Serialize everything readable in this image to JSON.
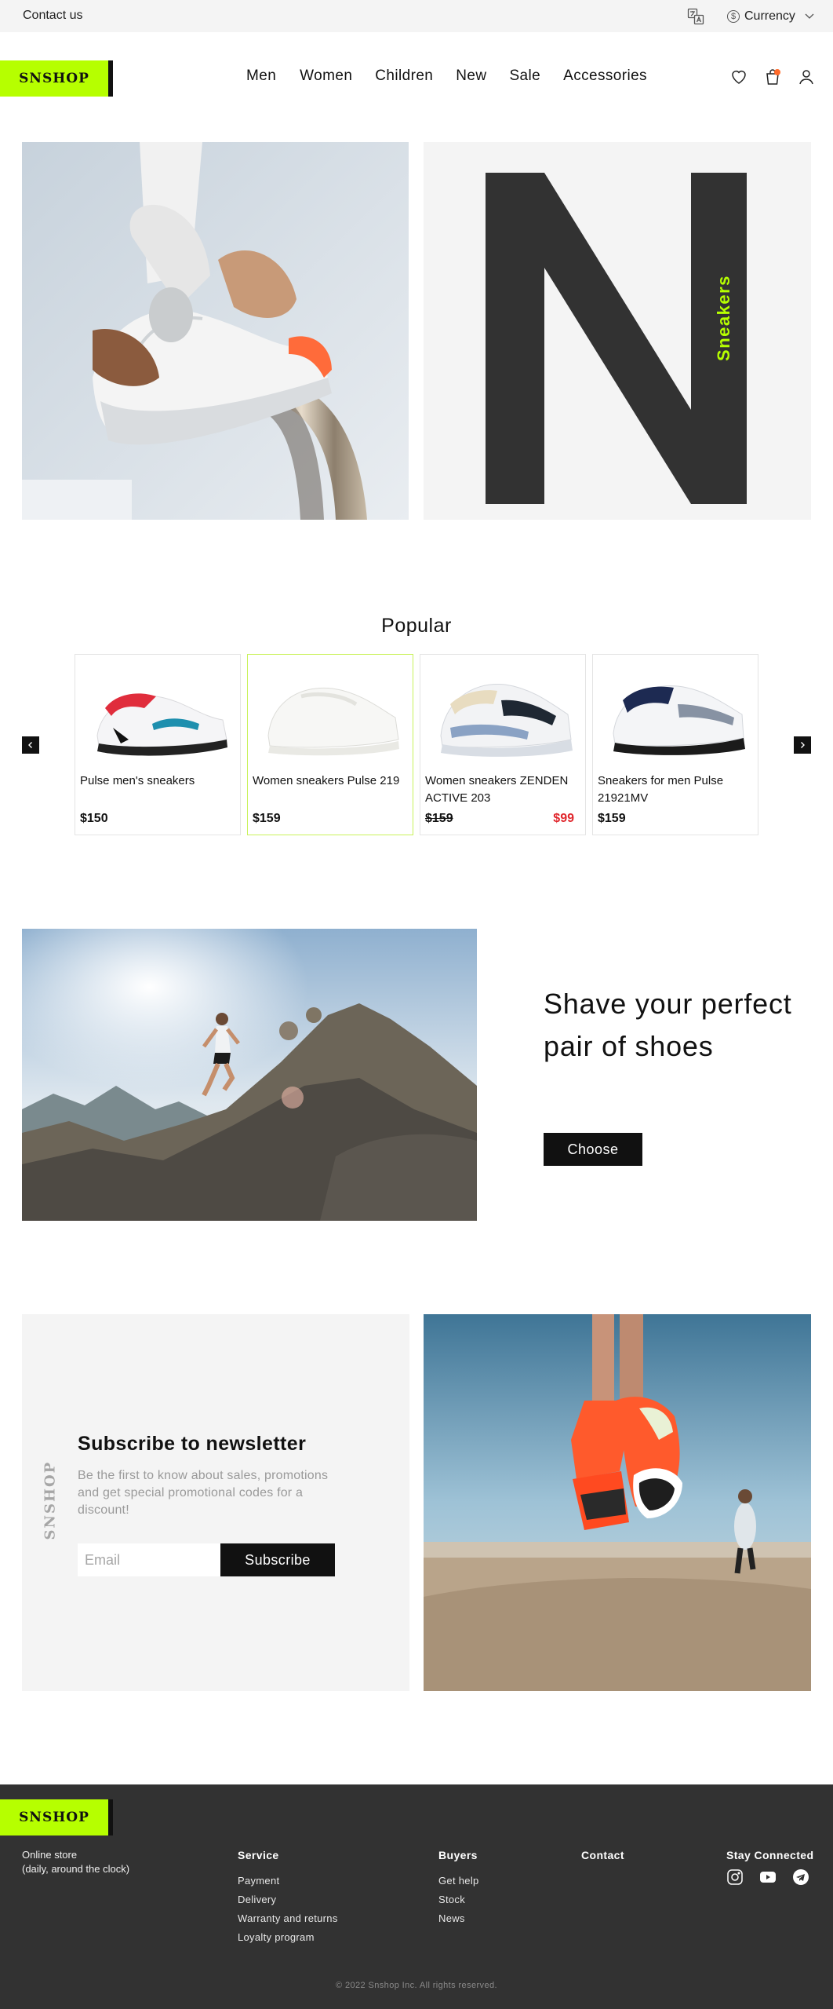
{
  "topbar": {
    "contact_label": "Contact us",
    "currency_label": "Currency",
    "currency_symbol": "$"
  },
  "brand": {
    "name": "SNSHOP",
    "accent_color": "#b6ff00",
    "dark_color": "#323232"
  },
  "nav": {
    "items": [
      "Men",
      "Women",
      "Children",
      "New",
      "Sale",
      "Accessories"
    ]
  },
  "header_icons": [
    "heart-icon",
    "cart-icon",
    "user-icon"
  ],
  "hero": {
    "letter": "N",
    "vertical_label": "Sneakers"
  },
  "popular": {
    "title": "Popular",
    "products": [
      {
        "name": "Pulse men's sneakers",
        "price": "$150",
        "old_price": "",
        "sale_price": ""
      },
      {
        "name": "Women sneakers Pulse 219",
        "price": "$159",
        "old_price": "",
        "sale_price": ""
      },
      {
        "name": "Women sneakers ZENDEN ACTIVE 203",
        "price": "",
        "old_price": "$159",
        "sale_price": "$99"
      },
      {
        "name": "Sneakers for men Pulse 21921MV",
        "price": "$159",
        "old_price": "",
        "sale_price": ""
      }
    ]
  },
  "promo": {
    "title": "Shave your perfect pair of shoes",
    "button_label": "Choose"
  },
  "newsletter": {
    "title": "Subscribe to newsletter",
    "description": "Be the first to know about sales, promotions and get special promotional codes for a discount!",
    "email_placeholder": "Email",
    "button_label": "Subscribe",
    "vertical_brand": "SNSHOP"
  },
  "footer": {
    "online_line1": "Online store",
    "online_line2": "(daily, around the clock)",
    "service_title": "Service",
    "service_links": [
      "Payment",
      "Delivery",
      "Warranty and returns",
      "Loyalty program"
    ],
    "buyers_title": "Buyers",
    "buyers_links": [
      "Get help",
      "Stock",
      "News"
    ],
    "contact_title": "Contact",
    "social_title": "Stay Connected",
    "social_icons": [
      "instagram-icon",
      "youtube-icon",
      "telegram-icon"
    ],
    "copyright": "© 2022 Snshop Inc. All rights reserved."
  }
}
